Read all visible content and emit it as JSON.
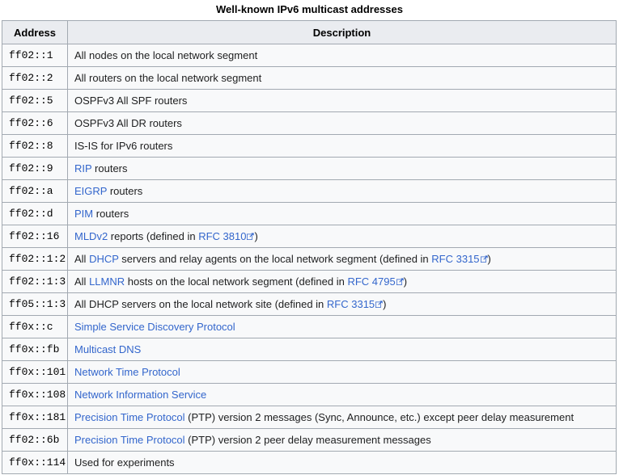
{
  "table": {
    "caption": "Well-known IPv6 multicast addresses",
    "columns": [
      {
        "key": "address",
        "label": "Address"
      },
      {
        "key": "description",
        "label": "Description"
      }
    ],
    "colors": {
      "link": "#3366cc",
      "text": "#202122",
      "header_bg": "#eaecf0",
      "cell_bg": "#f8f9fa",
      "border": "#a2a9b1"
    },
    "icons": {
      "external_link": "external-link-icon"
    },
    "rows": [
      {
        "address": "ff02::1",
        "description": "All nodes on the local network segment",
        "parts": [
          {
            "text": "All nodes on the local network segment",
            "link": false
          }
        ]
      },
      {
        "address": "ff02::2",
        "description": "All routers on the local network segment",
        "parts": [
          {
            "text": "All routers on the local network segment",
            "link": false
          }
        ]
      },
      {
        "address": "ff02::5",
        "description": "OSPFv3 All SPF routers",
        "parts": [
          {
            "text": "OSPFv3 All SPF routers",
            "link": false
          }
        ]
      },
      {
        "address": "ff02::6",
        "description": "OSPFv3 All DR routers",
        "parts": [
          {
            "text": "OSPFv3 All DR routers",
            "link": false
          }
        ]
      },
      {
        "address": "ff02::8",
        "description": "IS-IS for IPv6 routers",
        "parts": [
          {
            "text": "IS-IS for IPv6 routers",
            "link": false
          }
        ]
      },
      {
        "address": "ff02::9",
        "description": "RIP routers",
        "parts": [
          {
            "text": "RIP",
            "link": true
          },
          {
            "text": " routers",
            "link": false
          }
        ]
      },
      {
        "address": "ff02::a",
        "description": "EIGRP routers",
        "parts": [
          {
            "text": "EIGRP",
            "link": true
          },
          {
            "text": " routers",
            "link": false
          }
        ]
      },
      {
        "address": "ff02::d",
        "description": "PIM routers",
        "parts": [
          {
            "text": "PIM",
            "link": true
          },
          {
            "text": " routers",
            "link": false
          }
        ]
      },
      {
        "address": "ff02::16",
        "description": "MLDv2 reports (defined in RFC 3810)",
        "parts": [
          {
            "text": "MLDv2",
            "link": true
          },
          {
            "text": " reports (defined in ",
            "link": false
          },
          {
            "text": "RFC 3810",
            "link": true,
            "external": true
          },
          {
            "text": ")",
            "link": false
          }
        ]
      },
      {
        "address": "ff02::1:2",
        "description": "All DHCP servers and relay agents on the local network segment (defined in RFC 3315)",
        "parts": [
          {
            "text": "All ",
            "link": false
          },
          {
            "text": "DHCP",
            "link": true
          },
          {
            "text": " servers and relay agents on the local network segment (defined in ",
            "link": false
          },
          {
            "text": "RFC 3315",
            "link": true,
            "external": true
          },
          {
            "text": ")",
            "link": false
          }
        ]
      },
      {
        "address": "ff02::1:3",
        "description": "All LLMNR hosts on the local network segment (defined in RFC 4795)",
        "parts": [
          {
            "text": "All ",
            "link": false
          },
          {
            "text": "LLMNR",
            "link": true
          },
          {
            "text": " hosts on the local network segment (defined in ",
            "link": false
          },
          {
            "text": "RFC 4795",
            "link": true,
            "external": true
          },
          {
            "text": ")",
            "link": false
          }
        ]
      },
      {
        "address": "ff05::1:3",
        "description": "All DHCP servers on the local network site (defined in RFC 3315)",
        "parts": [
          {
            "text": "All DHCP servers on the local network site (defined in ",
            "link": false
          },
          {
            "text": "RFC 3315",
            "link": true,
            "external": true
          },
          {
            "text": ")",
            "link": false
          }
        ]
      },
      {
        "address": "ff0x::c",
        "description": "Simple Service Discovery Protocol",
        "parts": [
          {
            "text": "Simple Service Discovery Protocol",
            "link": true
          }
        ]
      },
      {
        "address": "ff0x::fb",
        "description": "Multicast DNS",
        "parts": [
          {
            "text": "Multicast DNS",
            "link": true
          }
        ]
      },
      {
        "address": "ff0x::101",
        "description": "Network Time Protocol",
        "parts": [
          {
            "text": "Network Time Protocol",
            "link": true
          }
        ]
      },
      {
        "address": "ff0x::108",
        "description": "Network Information Service",
        "parts": [
          {
            "text": "Network Information Service",
            "link": true
          }
        ]
      },
      {
        "address": "ff0x::181",
        "description": "Precision Time Protocol (PTP) version 2 messages (Sync, Announce, etc.) except peer delay measurement",
        "parts": [
          {
            "text": "Precision Time Protocol",
            "link": true
          },
          {
            "text": " (PTP) version 2 messages (Sync, Announce, etc.) except peer delay measurement",
            "link": false
          }
        ]
      },
      {
        "address": "ff02::6b",
        "description": "Precision Time Protocol (PTP) version 2 peer delay measurement messages",
        "parts": [
          {
            "text": "Precision Time Protocol",
            "link": true
          },
          {
            "text": " (PTP) version 2 peer delay measurement messages",
            "link": false
          }
        ]
      },
      {
        "address": "ff0x::114",
        "description": "Used for experiments",
        "parts": [
          {
            "text": "Used for experiments",
            "link": false
          }
        ]
      }
    ]
  }
}
